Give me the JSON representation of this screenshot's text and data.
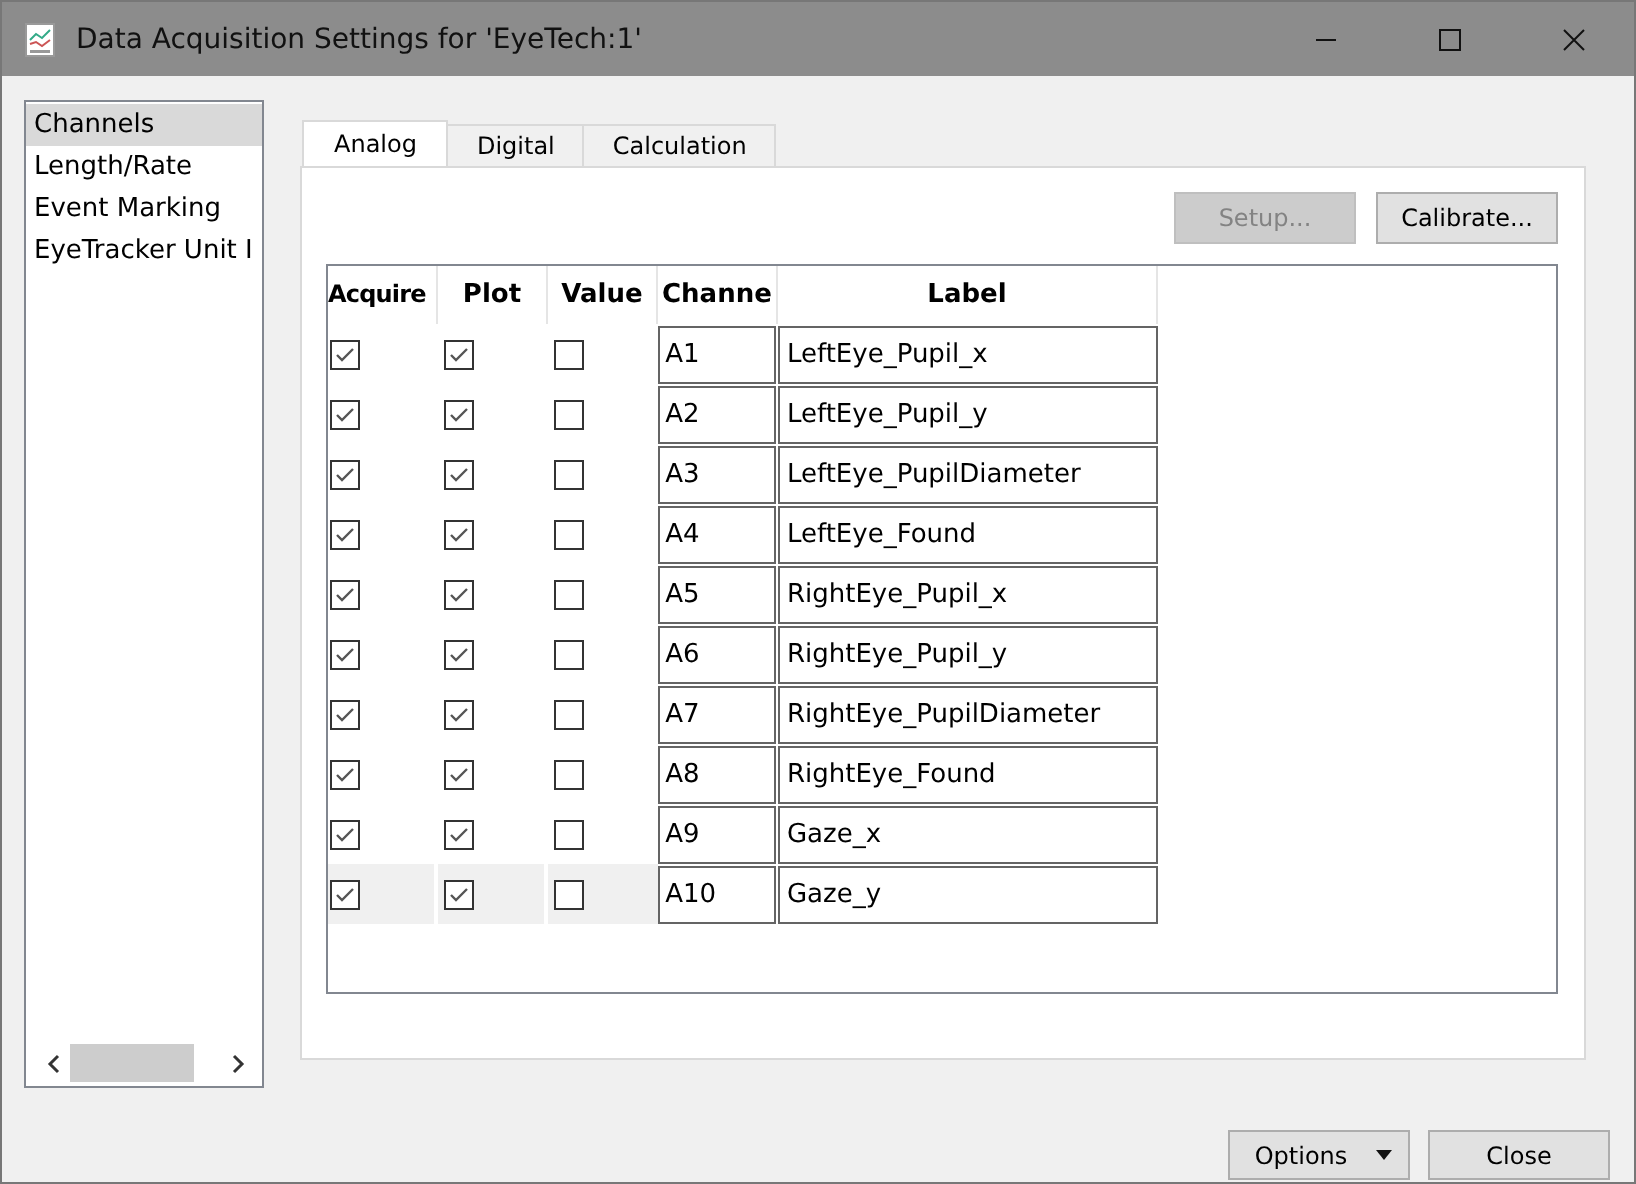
{
  "window": {
    "title": "Data Acquisition Settings for 'EyeTech:1'"
  },
  "sidebar": {
    "items": [
      {
        "label": "Channels",
        "selected": true
      },
      {
        "label": "Length/Rate",
        "selected": false
      },
      {
        "label": "Event Marking",
        "selected": false
      },
      {
        "label": "EyeTracker Unit I",
        "selected": false
      }
    ]
  },
  "tabs": [
    {
      "label": "Analog",
      "selected": true
    },
    {
      "label": "Digital",
      "selected": false
    },
    {
      "label": "Calculation",
      "selected": false
    }
  ],
  "toolbar": [
    {
      "label": "Setup...",
      "disabled": true
    },
    {
      "label": "Calibrate...",
      "disabled": false
    }
  ],
  "table": {
    "columns": [
      "Acquire",
      "Plot",
      "Value",
      "Channe",
      "Label"
    ],
    "rows": [
      {
        "acquire": true,
        "plot": true,
        "value": false,
        "channel": "A1",
        "label": "LeftEye_Pupil_x",
        "selected": false
      },
      {
        "acquire": true,
        "plot": true,
        "value": false,
        "channel": "A2",
        "label": "LeftEye_Pupil_y",
        "selected": false
      },
      {
        "acquire": true,
        "plot": true,
        "value": false,
        "channel": "A3",
        "label": "LeftEye_PupilDiameter",
        "selected": false
      },
      {
        "acquire": true,
        "plot": true,
        "value": false,
        "channel": "A4",
        "label": "LeftEye_Found",
        "selected": false
      },
      {
        "acquire": true,
        "plot": true,
        "value": false,
        "channel": "A5",
        "label": "RightEye_Pupil_x",
        "selected": false
      },
      {
        "acquire": true,
        "plot": true,
        "value": false,
        "channel": "A6",
        "label": "RightEye_Pupil_y",
        "selected": false
      },
      {
        "acquire": true,
        "plot": true,
        "value": false,
        "channel": "A7",
        "label": "RightEye_PupilDiameter",
        "selected": false
      },
      {
        "acquire": true,
        "plot": true,
        "value": false,
        "channel": "A8",
        "label": "RightEye_Found",
        "selected": false
      },
      {
        "acquire": true,
        "plot": true,
        "value": false,
        "channel": "A9",
        "label": "Gaze_x",
        "selected": false
      },
      {
        "acquire": true,
        "plot": true,
        "value": false,
        "channel": "A10",
        "label": "Gaze_y",
        "selected": true
      }
    ]
  },
  "buttons": [
    "Options",
    "Close"
  ]
}
